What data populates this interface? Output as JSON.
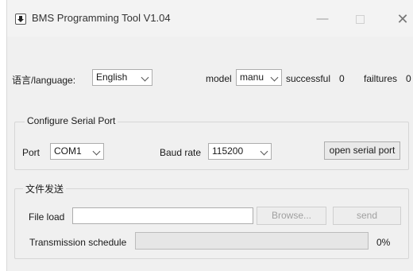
{
  "window": {
    "title": "BMS Programming Tool V1.04",
    "icon": "download-arrow-icon",
    "controls": {
      "minimize": "—",
      "close": "✕"
    }
  },
  "top_row": {
    "language_label": "语言/language:",
    "language_value": "English",
    "model_label": "model",
    "model_value": "manu",
    "successful_label": "successful",
    "successful_count": "0",
    "failures_label": "failtures",
    "failures_count": "0"
  },
  "serial_group": {
    "title": "Configure Serial Port",
    "port_label": "Port",
    "port_value": "COM1",
    "baud_label": "Baud rate",
    "baud_value": "115200",
    "open_button": "open serial port"
  },
  "file_group": {
    "title": "文件发送",
    "file_load_label": "File load",
    "file_path_value": "",
    "browse_button": "Browse...",
    "send_button": "send",
    "schedule_label": "Transmission schedule",
    "progress_percent_text": "0%",
    "progress_fraction": 0
  },
  "colors": {
    "window_bg": "#f0f0f0",
    "progress_fill": "#06b025",
    "disabled_text": "#a0a0a0"
  }
}
